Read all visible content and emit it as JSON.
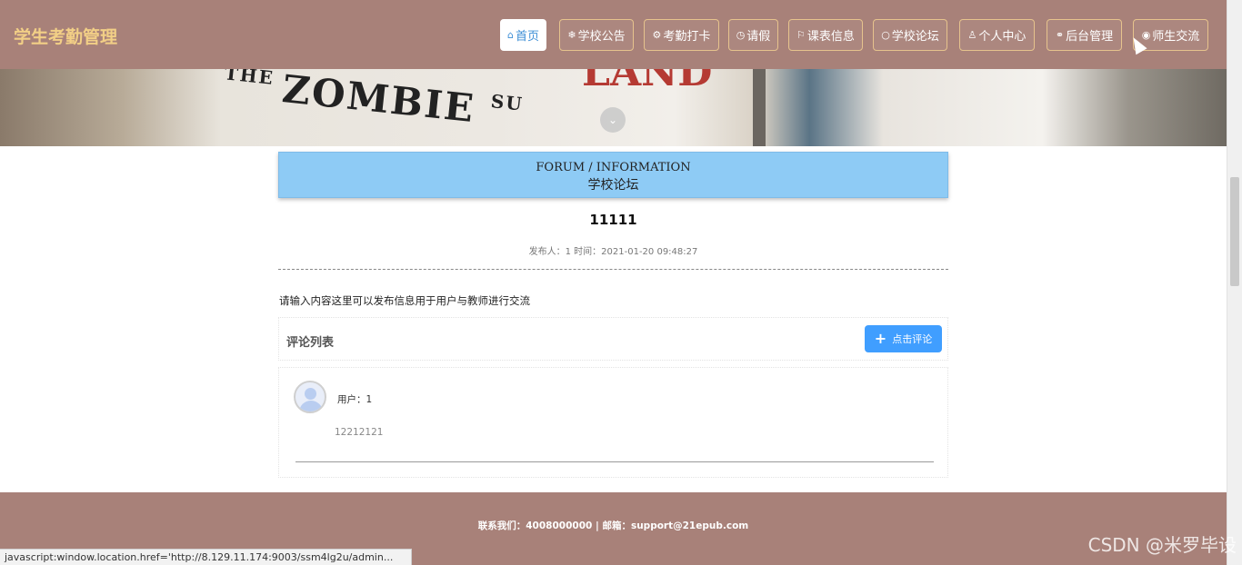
{
  "brand": "学生考勤管理",
  "nav": [
    {
      "label": "首页",
      "icon": "home-icon",
      "glyph": "⌂",
      "active": true
    },
    {
      "label": "学校公告",
      "icon": "snowflake-icon",
      "glyph": "❄",
      "active": false
    },
    {
      "label": "考勤打卡",
      "icon": "gear-icon",
      "glyph": "⚙",
      "active": false
    },
    {
      "label": "请假",
      "icon": "clock-icon",
      "glyph": "◷",
      "active": false
    },
    {
      "label": "课表信息",
      "icon": "flag-icon",
      "glyph": "⚐",
      "active": false
    },
    {
      "label": "学校论坛",
      "icon": "chat-icon",
      "glyph": "○",
      "active": false
    },
    {
      "label": "个人中心",
      "icon": "user-icon",
      "glyph": "♙",
      "active": false
    },
    {
      "label": "后台管理",
      "icon": "link-icon",
      "glyph": "⚭",
      "active": false
    },
    {
      "label": "师生交流",
      "icon": "globe-icon",
      "glyph": "◉",
      "active": false
    }
  ],
  "banner": {
    "book_text_small": "THE",
    "book_text": "ZOMBIE",
    "book_text_suffix": "SU"
  },
  "section": {
    "title_en": "FORUM / INFORMATION",
    "title_cn": "学校论坛"
  },
  "post": {
    "title": "11111",
    "meta": "发布人：1 时间：2021-01-20 09:48:27",
    "content": "请输入内容这里可以发布信息用于用户与教师进行交流"
  },
  "comments": {
    "header": "评论列表",
    "add_button": "点击评论",
    "items": [
      {
        "user": "用户：1",
        "text": "12212121"
      }
    ]
  },
  "footer": {
    "text": "联系我们：4008000000 | 邮箱：support@21epub.com"
  },
  "status_bar": "javascript:window.location.href='http://8.129.11.174:9003/ssm4lg2u/admin...",
  "watermark": "CSDN @米罗毕设",
  "colors": {
    "header_bg": "#a88179",
    "brand": "#f2cf86",
    "title_bg": "#8ecbf5",
    "button_blue": "#409eff"
  }
}
